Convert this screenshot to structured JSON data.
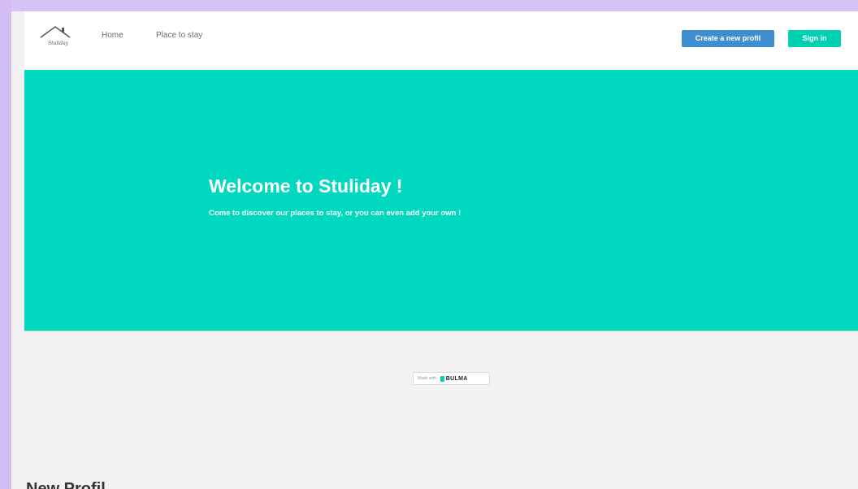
{
  "navbar": {
    "logo_text": "Stuliday",
    "links": [
      "Home",
      "Place to stay"
    ],
    "create_profile_label": "Create a new profil",
    "sign_in_label": "Sign in"
  },
  "hero": {
    "title": "Welcome to Stuliday !",
    "subtitle": "Come to discover our places to stay, or you can even add your own !"
  },
  "footer": {
    "made_with": "Made with",
    "bulma": "BULMA"
  },
  "below_fold": {
    "heading": "New Profil"
  },
  "colors": {
    "primary": "#00d1b2",
    "hero": "#00d8bf",
    "info": "#3e8ed0"
  }
}
